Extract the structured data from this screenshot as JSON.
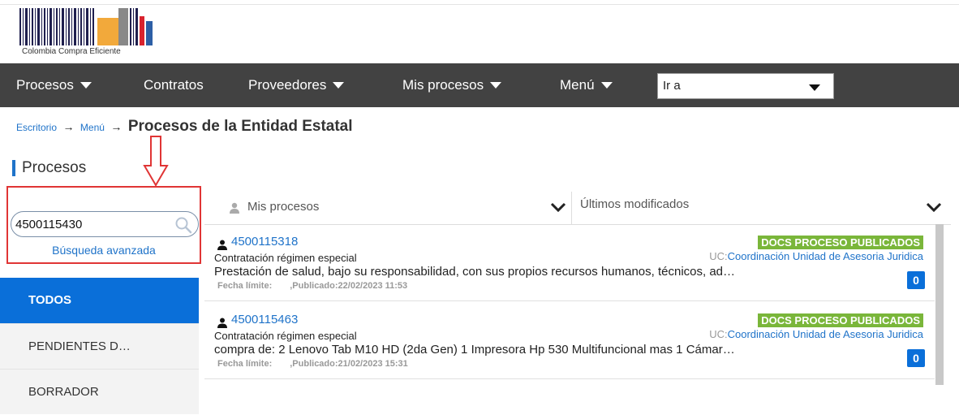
{
  "logo": {
    "text": "Colombia Compra Eficiente",
    "colors": {
      "bars": "#1f1f4e",
      "yellow": "#f2a93b",
      "gray": "#888888",
      "red": "#d9232e",
      "blue": "#2d5fa6"
    }
  },
  "nav": {
    "items": [
      {
        "label": "Procesos",
        "dropdown": true
      },
      {
        "label": "Contratos",
        "dropdown": false
      },
      {
        "label": "Proveedores",
        "dropdown": true
      },
      {
        "label": "Mis procesos",
        "dropdown": true
      },
      {
        "label": "Menú",
        "dropdown": true
      }
    ],
    "goto": {
      "value": "Ir a"
    },
    "background": "#424242"
  },
  "breadcrumb": {
    "home": "Escritorio",
    "menu": "Menú",
    "arrow": "→",
    "current": "Procesos de la Entidad Estatal"
  },
  "section": {
    "title": "Procesos"
  },
  "search": {
    "value": "4500115430",
    "advanced_label": "Búsqueda avanzada"
  },
  "sidebar": {
    "items": [
      {
        "label": "TODOS",
        "active": true
      },
      {
        "label": "PENDIENTES D…",
        "active": false
      },
      {
        "label": "BORRADOR",
        "active": false
      }
    ]
  },
  "filters": {
    "left": "Mis procesos",
    "right": "Últimos modificados"
  },
  "list": [
    {
      "id": "4500115318",
      "type": "Contratación régimen especial",
      "status": "DOCS PROCESO PUBLICADOS",
      "uc_prefix": "UC:",
      "uc": "Coordinación Unidad de Asesoria Juridica",
      "description": "Prestación de salud, bajo su responsabilidad, con sus propios recursos humanos, técnicos, ad…",
      "deadline_label": "Fecha límite:",
      "published": ",Publicado:22/02/2023 11:53",
      "count": "0"
    },
    {
      "id": "4500115463",
      "type": "Contratación régimen especial",
      "status": "DOCS PROCESO PUBLICADOS",
      "uc_prefix": "UC:",
      "uc": "Coordinación Unidad de Asesoria Juridica",
      "description": "compra de: 2 Lenovo Tab M10 HD (2da Gen) 1 Impresora Hp 530 Multifuncional mas 1 Cámar…",
      "deadline_label": "Fecha límite:",
      "published": ",Publicado:21/02/2023 15:31",
      "count": "0"
    }
  ],
  "colors": {
    "accent": "#0a6fd9",
    "link": "#1f73c9",
    "status_green": "#7ab63a",
    "highlight_red": "#e03535"
  }
}
